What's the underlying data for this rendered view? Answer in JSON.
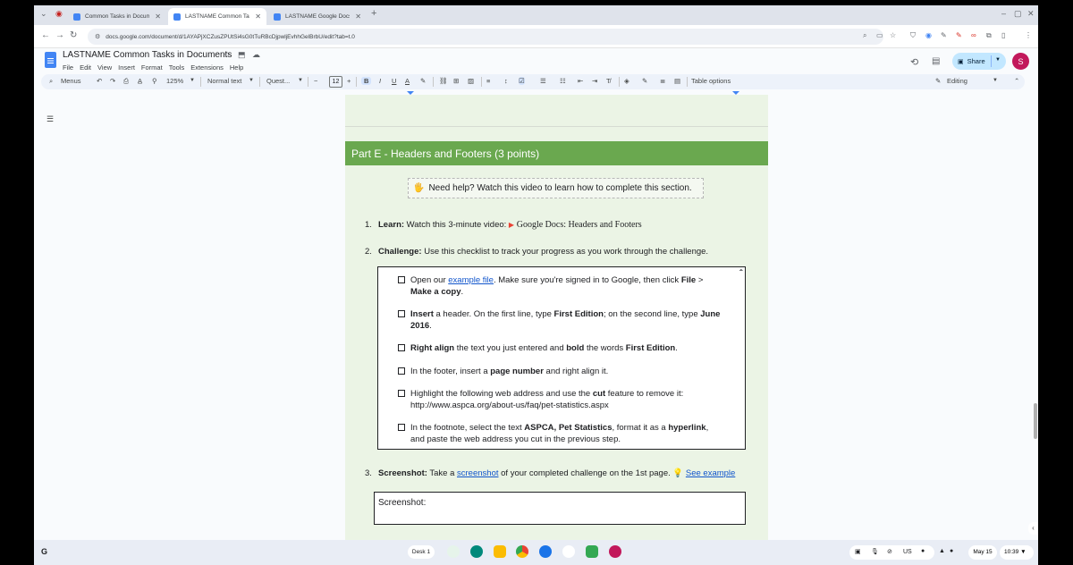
{
  "browser": {
    "tabs": [
      {
        "label": "Common Tasks in Documents"
      },
      {
        "label": "LASTNAME Common Tasks in"
      },
      {
        "label": "LASTNAME Google Docs - Hea"
      }
    ],
    "new_tab": "+",
    "url": "docs.google.com/document/d/1AYAPjXCZusZPUtSi4sG0tTuRBcDjpwljEvhhGelBrbU/edit?tab=t.0",
    "window_controls": {
      "minimize": "–",
      "restore": "▢",
      "close": "✕"
    }
  },
  "docs": {
    "title": "LASTNAME Common Tasks in Documents",
    "menu": [
      "File",
      "Edit",
      "View",
      "Insert",
      "Format",
      "Tools",
      "Extensions",
      "Help"
    ],
    "share_label": "Share",
    "avatar_letter": "S",
    "toolbar": {
      "menus_label": "Menus",
      "zoom": "125%",
      "style": "Normal text",
      "font": "Quest...",
      "font_size": "12",
      "table_options": "Table options",
      "mode": "Editing"
    }
  },
  "document": {
    "section_header": "Part E - Headers and Footers (3 points)",
    "help_text": "Need help? Watch this video to learn how to complete this section.",
    "item1": {
      "num": "1.",
      "label": "Learn:",
      "text": " Watch this 3-minute video: ",
      "video_title": "Google Docs: Headers and Footers"
    },
    "item2": {
      "num": "2.",
      "label": "Challenge:",
      "text": " Use this checklist to track your progress as you work through the challenge."
    },
    "checklist": {
      "c1": {
        "a": "Open our ",
        "link": "example file",
        "b": ". Make sure you're signed in to Google, then click ",
        "bold1": "File",
        "c": " > ",
        "bold2": "Make a copy",
        "d": "."
      },
      "c2": {
        "bold1": "Insert",
        "a": " a header. On the first line, type ",
        "bold2": "First Edition",
        "b": "; on the second line, type ",
        "bold3": "June 2016",
        "c": "."
      },
      "c3": {
        "bold1": "Right align",
        "a": " the text you just entered and ",
        "bold2": "bold",
        "b": " the words ",
        "bold3": "First Edition",
        "c": "."
      },
      "c4": {
        "a": "In the footer, insert a ",
        "bold1": "page number",
        "b": " and right align it."
      },
      "c5": {
        "a": "Highlight the following web address and use the ",
        "bold1": "cut",
        "b": " feature to remove it:",
        "url": "http://www.aspca.org/about-us/faq/pet-statistics.aspx"
      },
      "c6": {
        "a": "In the footnote, select the text ",
        "bold1": "ASPCA, Pet Statistics",
        "b": ", format it as a ",
        "bold2": "hyperlink",
        "c": ",",
        "d": "and paste the web address you cut in the previous step."
      }
    },
    "item3": {
      "num": "3.",
      "label": "Screenshot:",
      "a": " Take a ",
      "link1": "screenshot",
      "b": " of your completed challenge on the 1st page. ",
      "link2": "See example"
    },
    "screenshot_box_label": "Screenshot:"
  },
  "shelf": {
    "desk_label": "Desk 1",
    "locale": "US",
    "date": "May 15",
    "time": "10:39"
  }
}
